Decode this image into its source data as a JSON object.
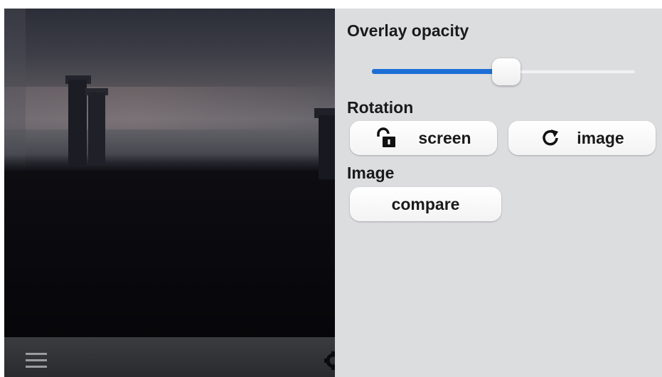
{
  "panel": {
    "opacity_label": "Overlay opacity",
    "opacity_value": 0.51,
    "rotation_label": "Rotation",
    "rotation_buttons": {
      "screen": {
        "label": "screen",
        "icon": "unlock-icon"
      },
      "image": {
        "label": "image",
        "icon": "rotate-icon"
      }
    },
    "image_label": "Image",
    "compare_label": "compare"
  },
  "toolbar": {
    "menu_icon": "menu-icon",
    "settings_icon": "gear-icon"
  },
  "colors": {
    "accent": "#1d6fd6",
    "panel_bg": "#dcdddf",
    "button_bg": "#ffffff"
  }
}
